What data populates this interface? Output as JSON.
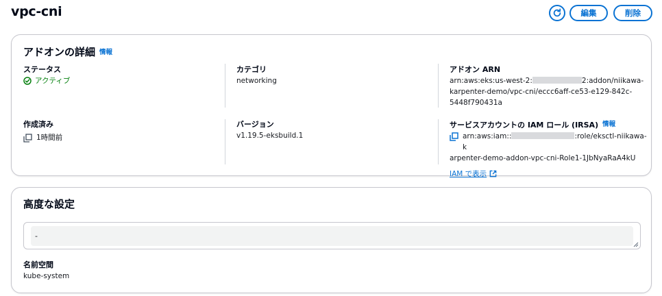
{
  "header": {
    "title": "vpc-cni",
    "edit_label": "編集",
    "delete_label": "削除"
  },
  "details": {
    "title": "アドオンの詳細",
    "info": "情報",
    "status": {
      "label": "ステータス",
      "value": "アクティブ"
    },
    "category": {
      "label": "カテゴリ",
      "value": "networking"
    },
    "arn": {
      "label": "アドオン ARN",
      "line1_prefix": "arn:aws:eks:us-west-2:",
      "line1_suffix": "2:addon/niikawa-",
      "line2": "karpenter-demo/vpc-cni/eccc6aff-ce53-e129-842c-",
      "line3": "5448f790431a"
    },
    "created": {
      "label": "作成済み",
      "value": "1時間前"
    },
    "version": {
      "label": "バージョン",
      "value": "v1.19.5-eksbuild.1"
    },
    "role": {
      "label": "サービスアカウントの IAM ロール (IRSA)",
      "info": "情報",
      "line1_prefix": "arn:aws:iam::",
      "line1_suffix": ":role/eksctl-niikawa-k",
      "line2": "arpenter-demo-addon-vpc-cni-Role1-1JbNyaRaA4kU",
      "link": "IAM で表示"
    }
  },
  "advanced": {
    "title": "高度な設定",
    "config_value": "-",
    "namespace": {
      "label": "名前空間",
      "value": "kube-system"
    }
  },
  "colors": {
    "accent": "#0972d3",
    "success": "#037f0c",
    "border": "#c6c6cd"
  }
}
